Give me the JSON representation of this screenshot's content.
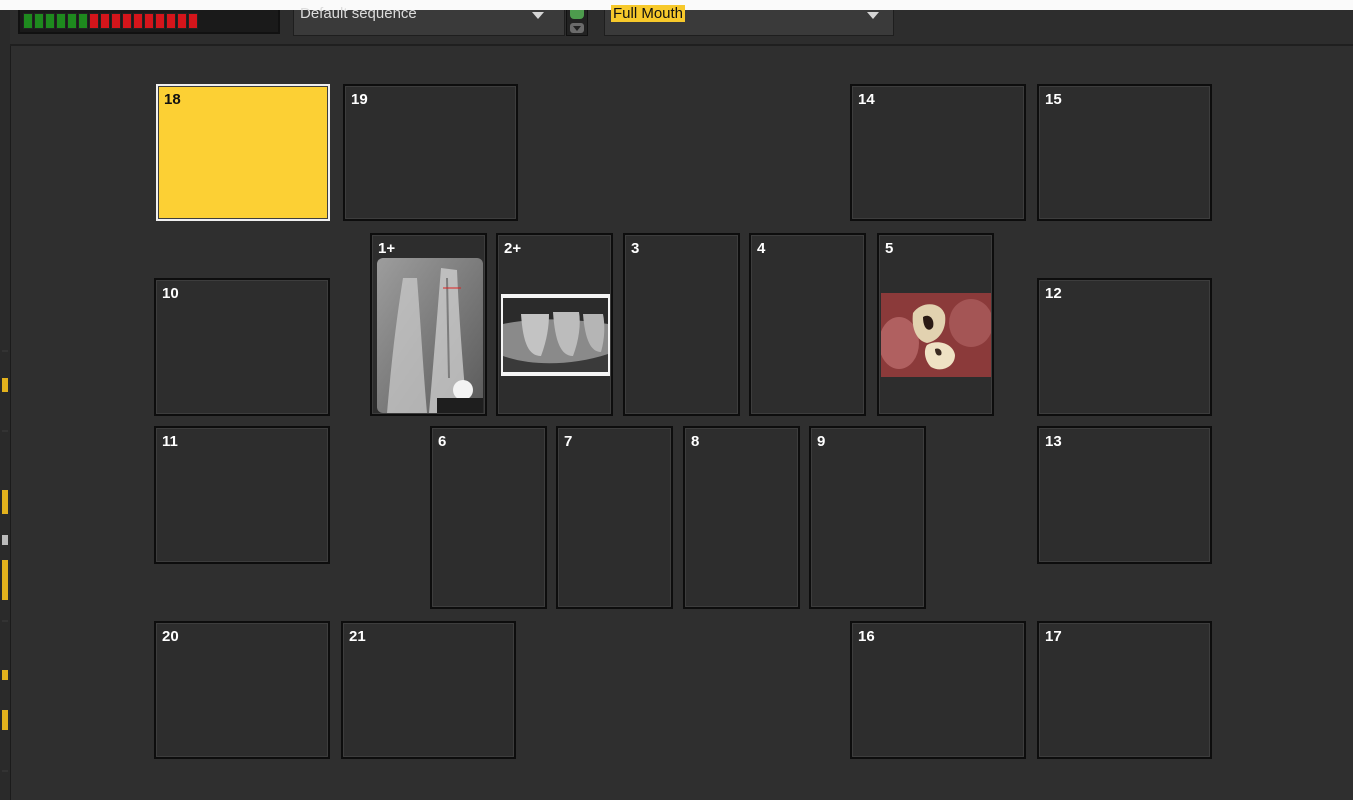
{
  "toolbar": {
    "sequence_value": "Default sequence",
    "template_value": "Full Mouth",
    "meter": {
      "green_segments": 6,
      "red_segments": 10
    }
  },
  "tiles": [
    {
      "label": "18",
      "selected": true
    },
    {
      "label": "19"
    },
    {
      "label": "14"
    },
    {
      "label": "15"
    },
    {
      "label": "1+",
      "image": "dental-xray-periapical"
    },
    {
      "label": "2+",
      "image": "dental-xray-bitewing"
    },
    {
      "label": "3"
    },
    {
      "label": "4"
    },
    {
      "label": "5",
      "image": "intraoral-photo"
    },
    {
      "label": "10"
    },
    {
      "label": "12"
    },
    {
      "label": "11"
    },
    {
      "label": "6"
    },
    {
      "label": "7"
    },
    {
      "label": "8"
    },
    {
      "label": "9"
    },
    {
      "label": "13"
    },
    {
      "label": "20"
    },
    {
      "label": "21"
    },
    {
      "label": "16"
    },
    {
      "label": "17"
    }
  ],
  "colors": {
    "selected_tile": "#fcd034",
    "background": "#2f2f2f",
    "meter_green": "#1e8a1e",
    "meter_red": "#d4151b"
  }
}
